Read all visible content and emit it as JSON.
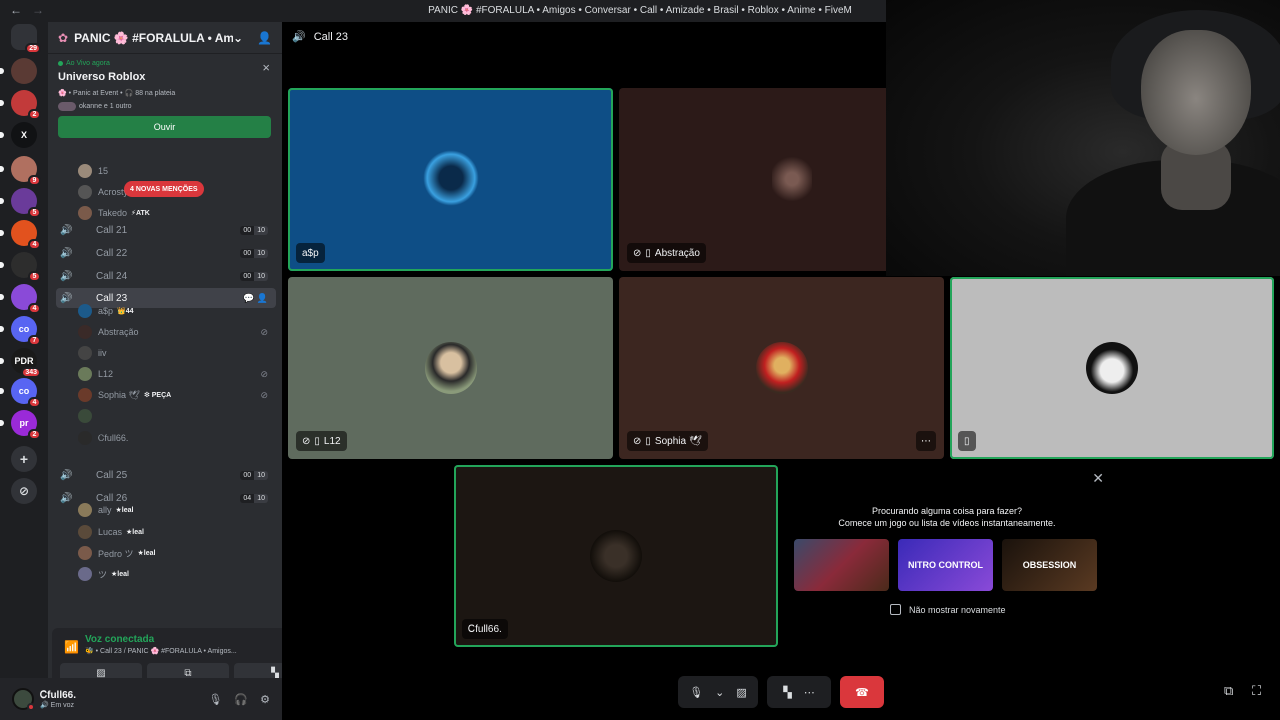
{
  "titlebar": {
    "back": "←",
    "forward": "→",
    "title": "PANIC 🌸 #FORALULA • Amigos • Conversar • Call • Amizade • Brasil • Roblox • Anime • FiveM"
  },
  "guilds": [
    {
      "label": "",
      "badge": "29",
      "color": "#313338",
      "icon": "discord-home-icon"
    },
    {
      "label": "",
      "badge": "",
      "color": "#5a3a34",
      "icon": "server-icon"
    },
    {
      "label": "",
      "badge": "2",
      "color": "#c23a3a",
      "icon": "server-icon"
    },
    {
      "label": "X",
      "badge": "",
      "color": "#111214",
      "icon": "server-icon"
    },
    {
      "label": "",
      "badge": "9",
      "color": "#b07060",
      "icon": "server-icon"
    },
    {
      "label": "",
      "badge": "5",
      "color": "#6a3b9a",
      "icon": "server-icon"
    },
    {
      "label": "",
      "badge": "4",
      "color": "#e2521e",
      "icon": "server-icon"
    },
    {
      "label": "",
      "badge": "5",
      "color": "#2d2d2d",
      "icon": "server-icon"
    },
    {
      "label": "",
      "badge": "4",
      "color": "#8a4ad8",
      "icon": "server-icon"
    },
    {
      "label": "co",
      "badge": "7",
      "color": "#5865f2",
      "icon": "server-icon"
    },
    {
      "label": "PDR",
      "badge": "343",
      "color": "#1a1a1a",
      "icon": "server-icon"
    },
    {
      "label": "co",
      "badge": "4",
      "color": "#5865f2",
      "icon": "server-icon"
    },
    {
      "label": "pr",
      "badge": "2",
      "color": "#9a2ad8",
      "icon": "server-icon"
    }
  ],
  "guild_add": "+",
  "guild_explore": "⊘",
  "server": {
    "name": "PANIC 🌸 #FORALULA • Amigo...",
    "chevron": "⌄",
    "invite_icon": "person-add-icon"
  },
  "stage": {
    "live": "Ao Vivo agora",
    "close": "×",
    "title": "Universo Roblox",
    "meta": "🌸 • Panic at Event • 🎧 88 na plateia",
    "listeners": "okanne e 1 outro",
    "listen_btn": "Ouvir"
  },
  "mentions": "4 NOVAS MENÇÕES",
  "top_members": [
    {
      "name": "15",
      "tag": "",
      "av": "#9a8a7a"
    },
    {
      "name": "Acrosty",
      "tag": "⚡ATK",
      "av": "#555"
    },
    {
      "name": "Takedo",
      "tag": "⚡ATK",
      "av": "#7a5a4a"
    }
  ],
  "channels": [
    {
      "name": "Call 21",
      "a": "00",
      "b": "10"
    },
    {
      "name": "Call 22",
      "a": "00",
      "b": "10"
    },
    {
      "name": "Call 24",
      "a": "00",
      "b": "10"
    },
    {
      "name": "Call 23",
      "a": "",
      "b": ""
    },
    {
      "name": "Call 25",
      "a": "00",
      "b": "10"
    },
    {
      "name": "Call 26",
      "a": "04",
      "b": "10"
    }
  ],
  "call23_members": [
    {
      "name": "a$p",
      "tag": "👑44",
      "av": "#1c5a8a"
    },
    {
      "name": "Abstração",
      "tag": "",
      "av": "#3a2a28"
    },
    {
      "name": "iiv",
      "tag": "",
      "av": "#444"
    },
    {
      "name": "L12",
      "tag": "",
      "av": "#6a7a5a"
    },
    {
      "name": "Sophia 🕊",
      "tag": "❇ PEÇA",
      "av": "#6a3a2a"
    },
    {
      "name": "",
      "tag": "",
      "av": "#3a4a3a"
    },
    {
      "name": "Ꮯfull66.",
      "tag": "",
      "av": "#2a2a2a"
    }
  ],
  "call26_members": [
    {
      "name": "ally",
      "tag": "★leal",
      "av": "#8a7a5a"
    },
    {
      "name": "Lucas",
      "tag": "★leal",
      "av": "#5a4a3a"
    },
    {
      "name": "Pedro ツ",
      "tag": "★leal",
      "av": "#7a5a4a"
    },
    {
      "name": "ツ",
      "tag": "★leal",
      "av": "#6a6a8a"
    }
  ],
  "voice": {
    "title": "Voz conectada",
    "sub": "🐝 • Call 23 / PANIC 🌸 #FORALULA • Amigos...",
    "camera": "▨",
    "screen": "⧉",
    "activity": "▚"
  },
  "user": {
    "name": "Ꮯfull66.",
    "status": "🔊 Em voz",
    "mic": "🎙",
    "headset": "🎧",
    "settings": "⚙"
  },
  "call": {
    "header": "Call 23",
    "speaker": "🔊"
  },
  "tiles": [
    {
      "label": "a$p",
      "mute": false,
      "mobile": false
    },
    {
      "label": "Abstração",
      "mute": true,
      "mobile": true
    },
    {
      "label": "L12",
      "mute": true,
      "mobile": true
    },
    {
      "label": "Sophia 🕊",
      "mute": true,
      "mobile": true
    },
    {
      "label": "",
      "mute": false,
      "mobile": true
    },
    {
      "label": "Ꮯfull66.",
      "mute": false,
      "mobile": false
    }
  ],
  "more": "⋯",
  "activity": {
    "close": "✕",
    "line1": "Procurando alguma coisa para fazer?",
    "line2": "Comece um jogo ou lista de vídeos instantaneamente.",
    "games": [
      {
        "name": "",
        "color": "#5a2a3a"
      },
      {
        "name": "NITRO CONTROL",
        "color": "#5a2ad8"
      },
      {
        "name": "OBSESSION",
        "color": "#2a1a12"
      }
    ],
    "dont_show": "Não mostrar novamente"
  },
  "controls": {
    "mic": "🎙",
    "chev": "⌄",
    "cam": "▨",
    "activities": "▚",
    "more": "⋯",
    "hangup": "☎",
    "popout": "⧉",
    "fullscreen": "⛶"
  }
}
